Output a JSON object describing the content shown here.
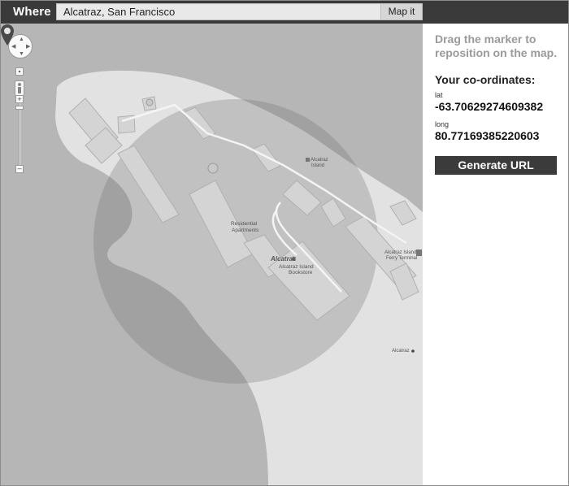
{
  "header": {
    "brand": "Where",
    "search_value": "Alcatraz, San Francisco",
    "map_button": "Map it"
  },
  "map": {
    "labels": {
      "alcatraz_top": "Alcatraz",
      "alcatraz_top2": "Island",
      "residential_1": "Residential",
      "residential_2": "Apartments",
      "alcatraz": "Alcatraz",
      "bookstore_1": "Alcatraz Island",
      "bookstore_2": "Bookstore",
      "ferry_1": "Alcatraz Island",
      "ferry_2": "Ferry Terminal",
      "alcatraz_right": "Alcatraz"
    }
  },
  "panel": {
    "hint": "Drag the marker to reposition on the map.",
    "coords_title": "Your co-ordinates:",
    "lat_label": "lat",
    "lat_value": "-63.70629274609382",
    "long_label": "long",
    "long_value": "80.77169385220603",
    "generate_button": "Generate URL"
  },
  "colors": {
    "header_bg": "#3a3a3a",
    "map_water": "#b6b6b6",
    "land": "#e2e2e2",
    "button_bg": "#3b3b3b"
  }
}
